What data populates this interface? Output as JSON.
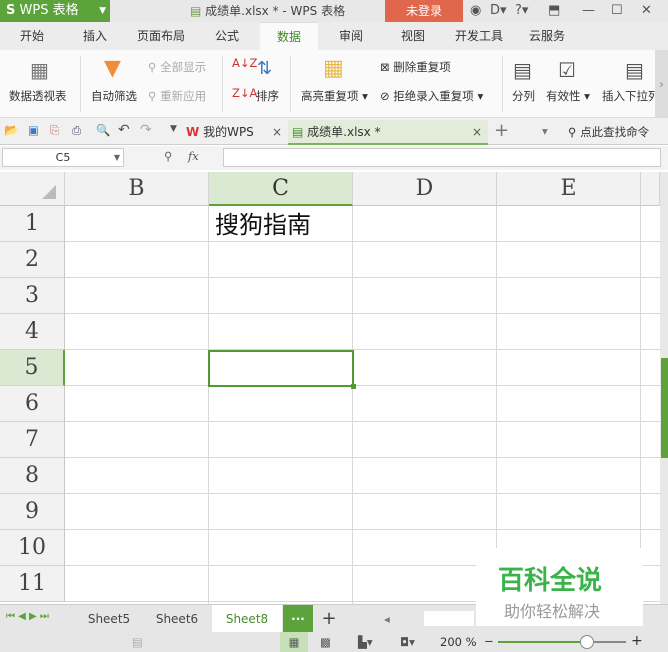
{
  "titlebar": {
    "app_label": "WPS 表格",
    "logo_glyph": "S",
    "title": "成绩单.xlsx * - WPS 表格",
    "login_label": "未登录",
    "icons": [
      "skin-icon",
      "cloud-icon",
      "help-icon",
      "pin-icon",
      "minimize-icon",
      "maximize-icon",
      "close-icon"
    ]
  },
  "menu": {
    "tabs": [
      "开始",
      "插入",
      "页面布局",
      "公式",
      "数据",
      "审阅",
      "视图",
      "开发工具",
      "云服务"
    ],
    "active": "数据"
  },
  "ribbon": {
    "pivot": "数据透视表",
    "autofilter": "自动筛选",
    "show_all": "全部显示",
    "reapply": "重新应用",
    "sort": "排序",
    "highlight_dup": "高亮重复项",
    "delete_dup": "删除重复项",
    "reject_dup": "拒绝录入重复项",
    "split": "分列",
    "validity": "有效性",
    "insert_dropdown": "插入下拉列"
  },
  "quickbar": {
    "my_wps": "我的WPS",
    "doc_tab": "成绩单.xlsx *",
    "search": "点此查找命令"
  },
  "formula": {
    "name_box": "C5",
    "fx": "fx",
    "value": ""
  },
  "grid": {
    "columns": [
      "B",
      "C",
      "D",
      "E"
    ],
    "selected_column": "C",
    "rows": [
      "1",
      "2",
      "3",
      "4",
      "5",
      "6",
      "7",
      "8",
      "9",
      "10",
      "11"
    ],
    "selected_row": "5",
    "cells": {
      "C1": "搜狗指南"
    }
  },
  "sheets": {
    "tabs": [
      "Sheet5",
      "Sheet6",
      "Sheet8"
    ],
    "active": "Sheet8",
    "more": "···",
    "add": "+"
  },
  "status": {
    "zoom": "200 %",
    "zoom_level_percent": 200
  },
  "watermark": {
    "title": "百科全说",
    "subtitle": "助你轻松解决"
  }
}
